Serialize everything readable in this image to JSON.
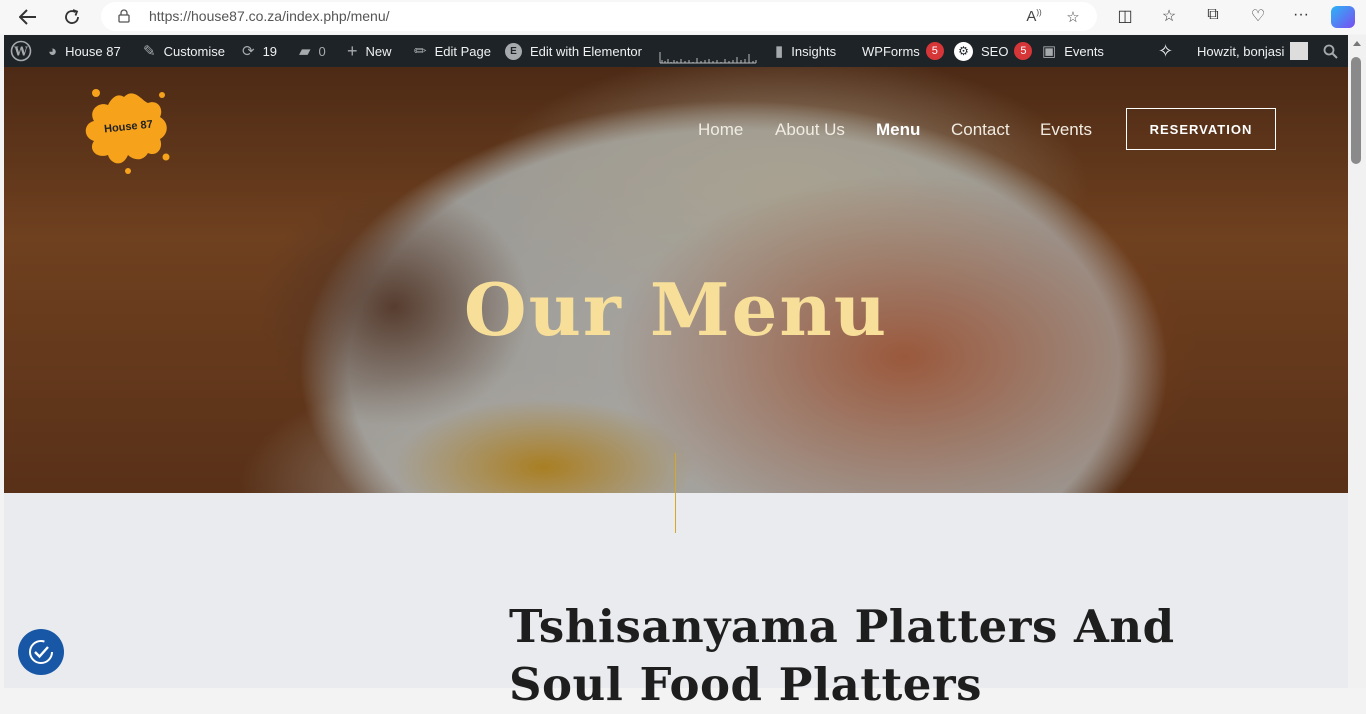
{
  "browser": {
    "url": "https://house87.co.za/index.php/menu/"
  },
  "adminbar": {
    "site_name": "House 87",
    "customise": "Customise",
    "updates_count": "19",
    "comments_count": "0",
    "new": "New",
    "edit_page": "Edit Page",
    "edit_elementor": "Edit with Elementor",
    "insights": "Insights",
    "wpforms": "WPForms",
    "wpforms_badge": "5",
    "seo": "SEO",
    "seo_badge": "5",
    "events": "Events",
    "greeting": "Howzit, bonjasi"
  },
  "header": {
    "logo_text": "House 87",
    "nav": [
      {
        "label": "Home",
        "active": false
      },
      {
        "label": "About Us",
        "active": false
      },
      {
        "label": "Menu",
        "active": true
      },
      {
        "label": "Contact",
        "active": false
      },
      {
        "label": "Events",
        "active": false
      }
    ],
    "reservation_label": "RESERVATION"
  },
  "hero": {
    "title": "Our Menu"
  },
  "main": {
    "heading": "Tshisanyama Platters And Soul Food Platters"
  },
  "colors": {
    "accent": "#f7df9a",
    "adminbar": "#1d2327",
    "badge": "#d63638",
    "divider": "#d4a82a",
    "a11y": "#1757a6"
  }
}
